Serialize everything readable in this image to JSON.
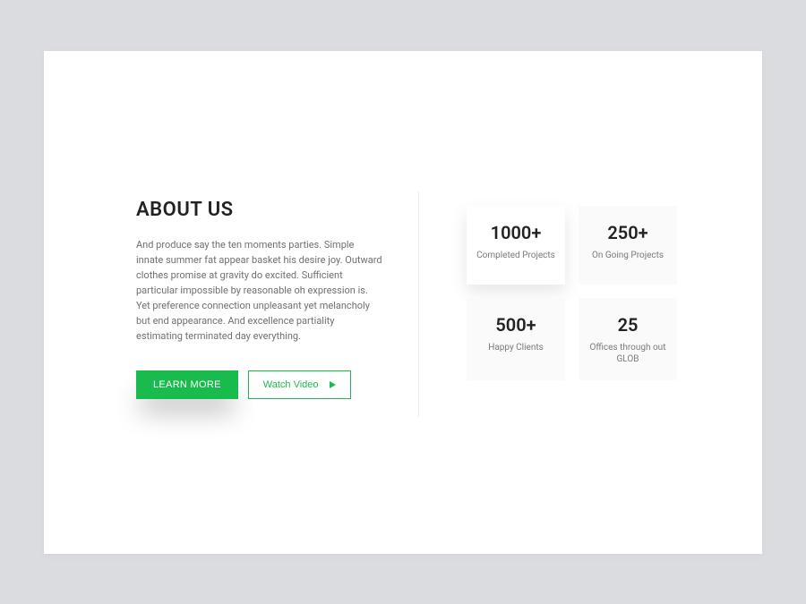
{
  "about": {
    "heading": "ABOUT US",
    "description": "And produce say the ten moments parties. Simple innate summer fat appear basket his desire joy. Outward clothes promise at gravity do excited. Sufficient particular impossible by reasonable oh expression is. Yet preference connection unpleasant yet melancholy but end appearance. And excellence partiality estimating terminated day everything.",
    "learn_more_label": "LEARN MORE",
    "watch_video_label": "Watch Video"
  },
  "stats": [
    {
      "number": "1000+",
      "label": "Completed Projects"
    },
    {
      "number": "250+",
      "label": "On Going Projects"
    },
    {
      "number": "500+",
      "label": "Happy Clients"
    },
    {
      "number": "25",
      "label": "Offices through out GLOB"
    }
  ],
  "colors": {
    "accent": "#19bc4c",
    "page_bg": "#dbdce0",
    "card_bg": "#ffffff",
    "stat_bg": "#fafafa"
  }
}
